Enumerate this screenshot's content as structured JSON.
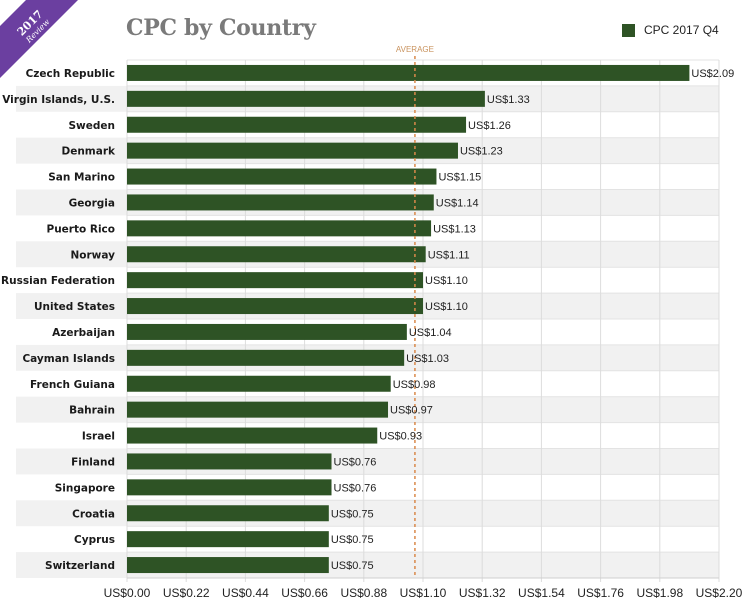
{
  "badge": {
    "year": "2017",
    "subtitle": "Review",
    "color": "#6b3fa0"
  },
  "chart_data": {
    "type": "bar",
    "orientation": "horizontal",
    "title": "CPC by Country",
    "xlabel": "",
    "ylabel": "",
    "xlim": [
      0,
      2.2
    ],
    "grid": true,
    "legend_position": "top-right",
    "series": [
      {
        "name": "CPC 2017 Q4",
        "color": "#2e5325",
        "values": [
          2.09,
          1.33,
          1.26,
          1.23,
          1.15,
          1.14,
          1.13,
          1.11,
          1.1,
          1.1,
          1.04,
          1.03,
          0.98,
          0.97,
          0.93,
          0.76,
          0.76,
          0.75,
          0.75,
          0.75
        ]
      }
    ],
    "categories": [
      "Czech Republic",
      "Virgin Islands, U.S.",
      "Sweden",
      "Denmark",
      "San Marino",
      "Georgia",
      "Puerto Rico",
      "Norway",
      "Russian Federation",
      "United States",
      "Azerbaijan",
      "Cayman Islands",
      "French Guiana",
      "Bahrain",
      "Israel",
      "Finland",
      "Singapore",
      "Croatia",
      "Cyprus",
      "Switzerland"
    ],
    "value_labels": [
      "US$2.09",
      "US$1.33",
      "US$1.26",
      "US$1.23",
      "US$1.15",
      "US$1.14",
      "US$1.13",
      "US$1.11",
      "US$1.10",
      "US$1.10",
      "US$1.04",
      "US$1.03",
      "US$0.98",
      "US$0.97",
      "US$0.93",
      "US$0.76",
      "US$0.76",
      "US$0.75",
      "US$0.75",
      "US$0.75"
    ],
    "x_ticks": [
      0,
      0.22,
      0.44,
      0.66,
      0.88,
      1.1,
      1.32,
      1.54,
      1.76,
      1.98,
      2.2
    ],
    "x_tick_labels": [
      "US$0.00",
      "US$0.22",
      "US$0.44",
      "US$0.66",
      "US$0.88",
      "US$1.10",
      "US$1.32",
      "US$1.54",
      "US$1.76",
      "US$1.98",
      "US$2.20"
    ],
    "reference_line": {
      "label": "AVERAGE",
      "value": 1.07,
      "color": "#d9894a"
    }
  }
}
